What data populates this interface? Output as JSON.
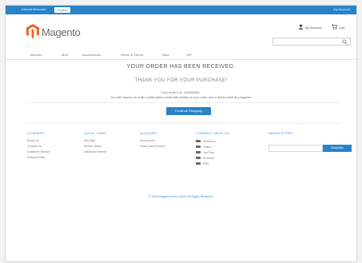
{
  "topbar": {
    "language_label": "Default Welcome",
    "language_switch": "English",
    "welcome": "My Account"
  },
  "header": {
    "logo_text": "Magento",
    "account_link": "My Account",
    "cart_link": "Cart",
    "search_placeholder": ""
  },
  "nav": {
    "items": [
      "Women",
      "Men",
      "Accessories",
      "Home & Decor",
      "Sale",
      "VIP"
    ]
  },
  "success": {
    "title": "YOUR ORDER HAS BEEN RECEIVED.",
    "subtitle": "THANK YOU FOR YOUR PURCHASE!",
    "order_line": "Your order # is: 100000051.",
    "info_line": "You will receive an order confirmation email with details of your order and a link to track its progress.",
    "continue_button": "Continue Shopping"
  },
  "footer": {
    "company": {
      "heading": "COMPANY",
      "links": [
        "About Us",
        "Contact Us",
        "Customer Service",
        "Privacy Policy"
      ]
    },
    "quick_links": {
      "heading": "QUICK LINKS",
      "links": [
        "Site Map",
        "Search Terms",
        "Advanced Search"
      ]
    },
    "account": {
      "heading": "ACCOUNT",
      "links": [
        "My Account",
        "Orders and Returns"
      ]
    },
    "payment": {
      "heading": "CONNECT WITH US",
      "items": [
        "Facebook",
        "Twitter",
        "YouTube",
        "Pinterest",
        "RSS"
      ]
    },
    "newsletter": {
      "heading": "NEWSLETTER",
      "button": "Subscribe"
    },
    "copyright": "© 2015 Magento Demo Store. All Rights Reserved."
  },
  "colors": {
    "accent": "#2a83c7",
    "link": "#3c8dd0",
    "logo_orange": "#f26322"
  },
  "icons": {
    "account": "user-icon",
    "cart": "cart-icon",
    "search": "search-icon"
  }
}
